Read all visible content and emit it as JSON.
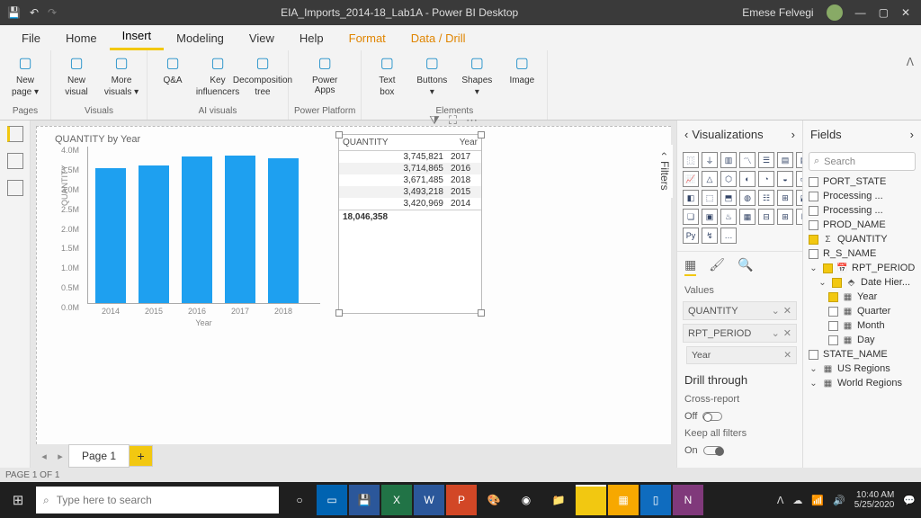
{
  "titlebar": {
    "title": "EIA_Imports_2014-18_Lab1A - Power BI Desktop",
    "user": "Emese Felvegi"
  },
  "menus": [
    "File",
    "Home",
    "Insert",
    "Modeling",
    "View",
    "Help",
    "Format",
    "Data / Drill"
  ],
  "active_menu": "Insert",
  "ribbon": {
    "groups": [
      {
        "label": "Pages",
        "buttons": [
          {
            "l1": "New",
            "l2": "page ▾"
          }
        ]
      },
      {
        "label": "Visuals",
        "buttons": [
          {
            "l1": "New",
            "l2": "visual"
          },
          {
            "l1": "More",
            "l2": "visuals ▾"
          }
        ]
      },
      {
        "label": "AI visuals",
        "buttons": [
          {
            "l1": "Q&A",
            "l2": ""
          },
          {
            "l1": "Key",
            "l2": "influencers"
          },
          {
            "l1": "Decomposition",
            "l2": "tree"
          }
        ]
      },
      {
        "label": "Power Platform",
        "buttons": [
          {
            "l1": "Power Apps",
            "l2": ""
          }
        ]
      },
      {
        "label": "Elements",
        "buttons": [
          {
            "l1": "Text",
            "l2": "box"
          },
          {
            "l1": "Buttons",
            "l2": "▾"
          },
          {
            "l1": "Shapes",
            "l2": "▾"
          },
          {
            "l1": "Image",
            "l2": ""
          }
        ]
      }
    ]
  },
  "chart_data": {
    "type": "bar",
    "title": "QUANTITY by Year",
    "categories": [
      "2014",
      "2015",
      "2016",
      "2017",
      "2018"
    ],
    "values": [
      3420969,
      3493218,
      3714865,
      3745821,
      3671485
    ],
    "xlabel": "Year",
    "ylabel": "QUANTITY",
    "ylim": [
      0,
      4000000
    ],
    "yticks": [
      "0.0M",
      "0.5M",
      "1.0M",
      "1.5M",
      "2.0M",
      "2.5M",
      "3.0M",
      "3.5M",
      "4.0M"
    ]
  },
  "table": {
    "cols": [
      "QUANTITY",
      "Year"
    ],
    "rows": [
      [
        "3,745,821",
        "2017"
      ],
      [
        "3,714,865",
        "2016"
      ],
      [
        "3,671,485",
        "2018"
      ],
      [
        "3,493,218",
        "2015"
      ],
      [
        "3,420,969",
        "2014"
      ]
    ],
    "total": "18,046,358"
  },
  "filters_label": "Filters",
  "pages": {
    "active": "Page 1",
    "status": "PAGE 1 OF 1"
  },
  "viz_pane": {
    "title": "Visualizations",
    "values_label": "Values",
    "wells": [
      {
        "name": "QUANTITY"
      },
      {
        "name": "RPT_PERIOD",
        "sub": "Year"
      }
    ],
    "drill": {
      "title": "Drill through",
      "cross": "Cross-report",
      "cross_state": "Off",
      "keep": "Keep all filters",
      "keep_state": "On"
    }
  },
  "fields_pane": {
    "title": "Fields",
    "search": "Search",
    "items": [
      {
        "name": "PORT_STATE",
        "chk": false,
        "ic": "",
        "ind": 0
      },
      {
        "name": "Processing ...",
        "chk": false,
        "ic": "",
        "ind": 0
      },
      {
        "name": "Processing ...",
        "chk": false,
        "ic": "",
        "ind": 0
      },
      {
        "name": "PROD_NAME",
        "chk": false,
        "ic": "",
        "ind": 0
      },
      {
        "name": "QUANTITY",
        "chk": true,
        "ic": "Σ",
        "ind": 0
      },
      {
        "name": "R_S_NAME",
        "chk": false,
        "ic": "",
        "ind": 0
      },
      {
        "name": "RPT_PERIOD",
        "chk": true,
        "ic": "📅",
        "ind": 0,
        "caret": "⌄"
      },
      {
        "name": "Date Hier...",
        "chk": true,
        "ic": "⬘",
        "ind": 1,
        "caret": "⌄"
      },
      {
        "name": "Year",
        "chk": true,
        "ic": "▦",
        "ind": 2
      },
      {
        "name": "Quarter",
        "chk": false,
        "ic": "▦",
        "ind": 2
      },
      {
        "name": "Month",
        "chk": false,
        "ic": "▦",
        "ind": 2
      },
      {
        "name": "Day",
        "chk": false,
        "ic": "▦",
        "ind": 2
      },
      {
        "name": "STATE_NAME",
        "chk": false,
        "ic": "",
        "ind": 0
      },
      {
        "name": "US Regions",
        "chk": false,
        "ic": "▦",
        "ind": 0,
        "caret": "⌄",
        "nochk": true
      },
      {
        "name": "World Regions",
        "chk": false,
        "ic": "▦",
        "ind": 0,
        "caret": "⌄",
        "nochk": true
      }
    ]
  },
  "taskbar": {
    "search": "Type here to search",
    "time": "10:40 AM",
    "date": "5/25/2020"
  }
}
